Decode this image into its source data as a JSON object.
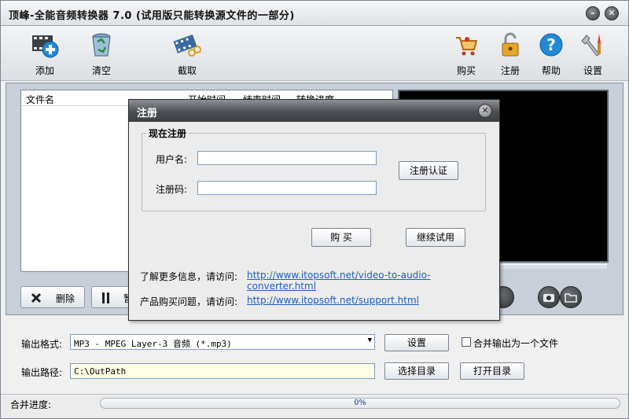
{
  "window": {
    "title": "顶峰-全能音频转换器 7.0 (试用版只能转换源文件的一部分)",
    "minimize_glyph": "–",
    "close_glyph": "✕"
  },
  "toolbar": {
    "add": "添加",
    "clear": "清空",
    "capture": "截取",
    "buy": "购买",
    "register": "注册",
    "help": "帮助",
    "settings": "设置"
  },
  "filelist": {
    "columns": [
      "文件名",
      "开始时间",
      "结束时间",
      "转换进度"
    ]
  },
  "controls": {
    "delete": "删除",
    "pause_partial": "暂"
  },
  "output": {
    "format_label": "输出格式:",
    "format_value": "MP3 - MPEG Layer-3 音频 (*.mp3)",
    "settings_button": "设置",
    "merge_label": "合并输出为一个文件",
    "merge_checked": false,
    "path_label": "输出路径:",
    "path_value": "C:\\OutPath",
    "choose_dir": "选择目录",
    "open_dir": "打开目录"
  },
  "status": {
    "merge_progress_label": "合并进度:",
    "progress_text": "0%",
    "progress_value": 0
  },
  "dialog": {
    "title": "注册",
    "group_title": "现在注册",
    "username_label": "用户名:",
    "username_value": "",
    "code_label": "注册码:",
    "code_value": "",
    "verify_button": "注册认证",
    "buy_button": "购 买",
    "continue_button": "继续试用",
    "info_label": "了解更多信息，请访问:",
    "info_link": "http://www.itopsoft.net/video-to-audio-converter.html",
    "buy_label": "产品购买问题，请访问:",
    "buy_link": "http://www.itopsoft.net/support.html"
  },
  "colors": {
    "accent_blue": "#1f8ad8",
    "link": "#1f5fc7",
    "dialog_title": "#4b4e53"
  }
}
